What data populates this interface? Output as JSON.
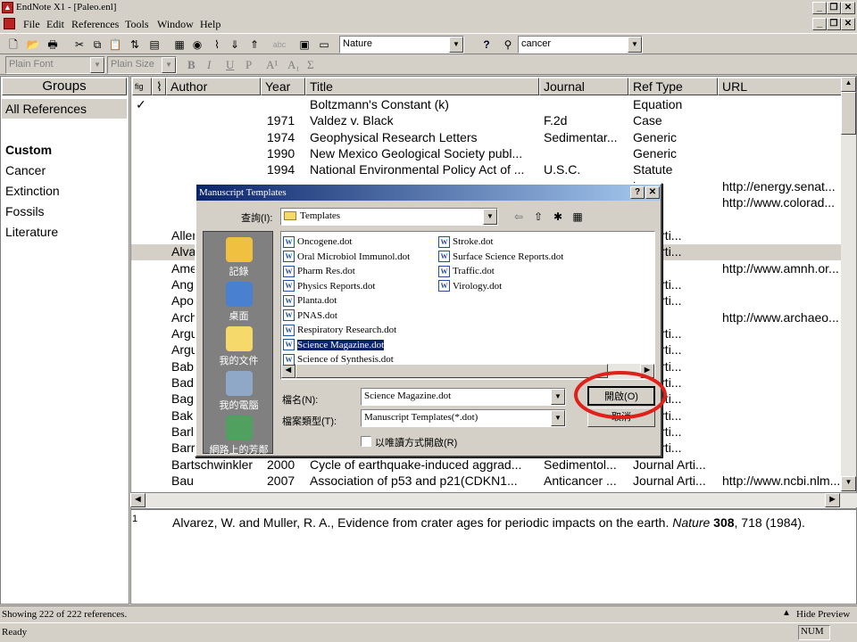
{
  "window": {
    "title": "EndNote X1 - [Paleo.enl]"
  },
  "menu": [
    "File",
    "Edit",
    "References",
    "Tools",
    "Window",
    "Help"
  ],
  "toolbar": {
    "style_value": "Nature",
    "search_value": "cancer",
    "help_glyph": "?"
  },
  "format": {
    "font": "Plain Font",
    "size": "Plain Size",
    "bold": "B",
    "italic": "I",
    "underline": "U",
    "plain": "P",
    "super": "A¹",
    "sub": "A₁",
    "symbol": "Σ"
  },
  "groups": {
    "header": "Groups",
    "all": "All References",
    "custom_title": "Custom",
    "items": [
      "Cancer",
      "Extinction",
      "Fossils",
      "Literature"
    ]
  },
  "columns": [
    "Author",
    "Year",
    "Title",
    "Journal",
    "Ref Type",
    "URL"
  ],
  "rows": [
    {
      "mark": "✓",
      "author": "",
      "year": "",
      "title": "Boltzmann's Constant (k)",
      "journal": "",
      "type": "Equation",
      "url": ""
    },
    {
      "mark": "",
      "author": "",
      "year": "1971",
      "title": "Valdez v. Black",
      "journal": "F.2d",
      "type": "Case",
      "url": ""
    },
    {
      "mark": "",
      "author": "",
      "year": "1974",
      "title": "Geophysical Research Letters",
      "journal": "Sedimentar...",
      "type": "Generic",
      "url": ""
    },
    {
      "mark": "",
      "author": "",
      "year": "1990",
      "title": "New Mexico Geological Society publ...",
      "journal": "",
      "type": "Generic",
      "url": ""
    },
    {
      "mark": "",
      "author": "",
      "year": "1994",
      "title": "National Environmental Policy Act of ...",
      "journal": "U.S.C.",
      "type": "Statute",
      "url": ""
    },
    {
      "mark": "",
      "author": "",
      "year": "",
      "title": "",
      "journal": "",
      "type": "ing",
      "url": "http://energy.senat..."
    },
    {
      "mark": "",
      "author": "",
      "year": "",
      "title": "",
      "journal": "",
      "type": "Page",
      "url": "http://www.colorad..."
    },
    {
      "mark": "",
      "author": "",
      "year": "",
      "title": "",
      "journal": "",
      "type": "",
      "url": ""
    },
    {
      "mark": "",
      "author": "Allen",
      "year": "",
      "title": "",
      "journal": "",
      "type": "nal Arti...",
      "url": ""
    },
    {
      "mark": "",
      "author": "Alva",
      "year": "",
      "title": "",
      "journal": "",
      "type": "nal Arti...",
      "url": ""
    },
    {
      "mark": "",
      "author": "Ame",
      "year": "",
      "title": "",
      "journal": "",
      "type": "Page",
      "url": "http://www.amnh.or..."
    },
    {
      "mark": "",
      "author": "Ang",
      "year": "",
      "title": "",
      "journal": "",
      "type": "nal Arti...",
      "url": ""
    },
    {
      "mark": "",
      "author": "Apo",
      "year": "",
      "title": "",
      "journal": "",
      "type": "nal Arti...",
      "url": ""
    },
    {
      "mark": "",
      "author": "Arch",
      "year": "",
      "title": "",
      "journal": "",
      "type": "Page",
      "url": "http://www.archaeo..."
    },
    {
      "mark": "",
      "author": "Argu",
      "year": "",
      "title": "",
      "journal": "",
      "type": "nal Arti...",
      "url": ""
    },
    {
      "mark": "",
      "author": "Argu",
      "year": "",
      "title": "",
      "journal": "",
      "type": "nal Arti...",
      "url": ""
    },
    {
      "mark": "",
      "author": "Bab",
      "year": "",
      "title": "",
      "journal": "",
      "type": "nal Arti...",
      "url": ""
    },
    {
      "mark": "",
      "author": "Bad",
      "year": "",
      "title": "",
      "journal": "",
      "type": "nal Arti...",
      "url": ""
    },
    {
      "mark": "",
      "author": "Bag",
      "year": "",
      "title": "",
      "journal": "",
      "type": "nal Arti...",
      "url": ""
    },
    {
      "mark": "",
      "author": "Bak",
      "year": "",
      "title": "",
      "journal": "",
      "type": "nal Arti...",
      "url": ""
    },
    {
      "mark": "",
      "author": "Barl",
      "year": "",
      "title": "",
      "journal": "",
      "type": "nal Arti...",
      "url": ""
    },
    {
      "mark": "",
      "author": "Barr",
      "year": "",
      "title": "",
      "journal": "",
      "type": "nal Arti...",
      "url": ""
    },
    {
      "mark": "",
      "author": "Bartschwinkler",
      "year": "2000",
      "title": "Cycle of earthquake-induced aggrad...",
      "journal": "Sedimentol...",
      "type": "Journal Arti...",
      "url": ""
    },
    {
      "mark": "",
      "author": "Bau",
      "year": "2007",
      "title": "Association of p53 and p21(CDKN1...",
      "journal": "Anticancer ...",
      "type": "Journal Arti...",
      "url": "http://www.ncbi.nlm..."
    }
  ],
  "preview": {
    "index": "1",
    "pre": "Alvarez, W. and Muller, R. A., Evidence from crater ages for periodic impacts on the earth. ",
    "journal": "Nature",
    "volume": "308",
    "post": ", 718 (1984)."
  },
  "status": {
    "count": "Showing 222 of 222 references.",
    "hide_preview": "Hide Preview",
    "ready": "Ready",
    "num": "NUM"
  },
  "dialog": {
    "title": "Manuscript Templates",
    "lookin_label": "查詢(I):",
    "folder": "Templates",
    "places": [
      "記錄",
      "桌面",
      "我的文件",
      "我的電腦",
      "網路上的芳鄰"
    ],
    "files_col1": [
      "Oncogene.dot",
      "Oral Microbiol Immunol.dot",
      "Pharm Res.dot",
      "Physics Reports.dot",
      "Planta.dot",
      "PNAS.dot",
      "Respiratory Research.dot",
      "Science Magazine.dot",
      "Science of Synthesis.dot"
    ],
    "files_col2": [
      "Stroke.dot",
      "Surface Science Reports.dot",
      "Traffic.dot",
      "Virology.dot"
    ],
    "filename_label": "檔名(N):",
    "filename_value": "Science Magazine.dot",
    "filetype_label": "檔案類型(T):",
    "filetype_value": "Manuscript Templates(*.dot)",
    "readonly_label": "以唯讀方式開啟(R)",
    "open_button": "開啟(O)",
    "cancel_button": "取消"
  },
  "colors": {
    "selection": "#0a246a",
    "highlight_ring": "#e0201a",
    "row_highlight": "#d4d0c8"
  }
}
